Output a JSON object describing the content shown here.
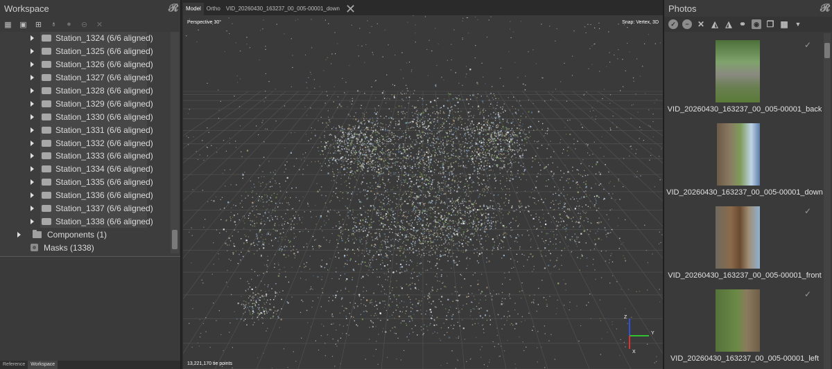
{
  "left_panel": {
    "title": "Workspace",
    "brand": "RX",
    "toolbar_icons": [
      "add-images-icon",
      "add-folder-icon",
      "import-icon",
      "settings-icon",
      "enable-icon",
      "disable-icon",
      "remove-icon"
    ],
    "stations": [
      "Station_1324 (6/6 aligned)",
      "Station_1325 (6/6 aligned)",
      "Station_1326 (6/6 aligned)",
      "Station_1327 (6/6 aligned)",
      "Station_1328 (6/6 aligned)",
      "Station_1329 (6/6 aligned)",
      "Station_1330 (6/6 aligned)",
      "Station_1331 (6/6 aligned)",
      "Station_1332 (6/6 aligned)",
      "Station_1333 (6/6 aligned)",
      "Station_1334 (6/6 aligned)",
      "Station_1335 (6/6 aligned)",
      "Station_1336 (6/6 aligned)",
      "Station_1337 (6/6 aligned)",
      "Station_1338 (6/6 aligned)"
    ],
    "components_label": "Components (1)",
    "masks_label": "Masks (1338)",
    "bottom_tabs": [
      "Reference",
      "Workspace"
    ]
  },
  "viewport": {
    "tabs": [
      "Model",
      "Ortho",
      "VID_20260430_163237_00_005-00001_down"
    ],
    "perspective_label": "Perspective 30°",
    "snap_label": "Snap: Vertex, 3D",
    "points_label": "13,221,170 tie points",
    "axis_labels": {
      "x": "X",
      "y": "Y",
      "z": "Z"
    },
    "colors": {
      "x_axis": "#e03030",
      "y_axis": "#30c030",
      "z_axis": "#3050e0"
    }
  },
  "right_panel": {
    "title": "Photos",
    "brand": "RX",
    "toolbar_icons": [
      "enable-icon",
      "disable-icon",
      "remove-icon",
      "flip-icon",
      "mirror-icon",
      "binoculars-icon",
      "mask-icon",
      "compare-icon",
      "grid-view-icon"
    ],
    "photos": [
      {
        "name": "VID_20260430_163237_00_005-00001_back",
        "checked": true
      },
      {
        "name": "VID_20260430_163237_00_005-00001_down",
        "checked": false
      },
      {
        "name": "VID_20260430_163237_00_005-00001_front",
        "checked": true
      },
      {
        "name": "VID_20260430_163237_00_005-00001_left",
        "checked": true
      }
    ]
  }
}
